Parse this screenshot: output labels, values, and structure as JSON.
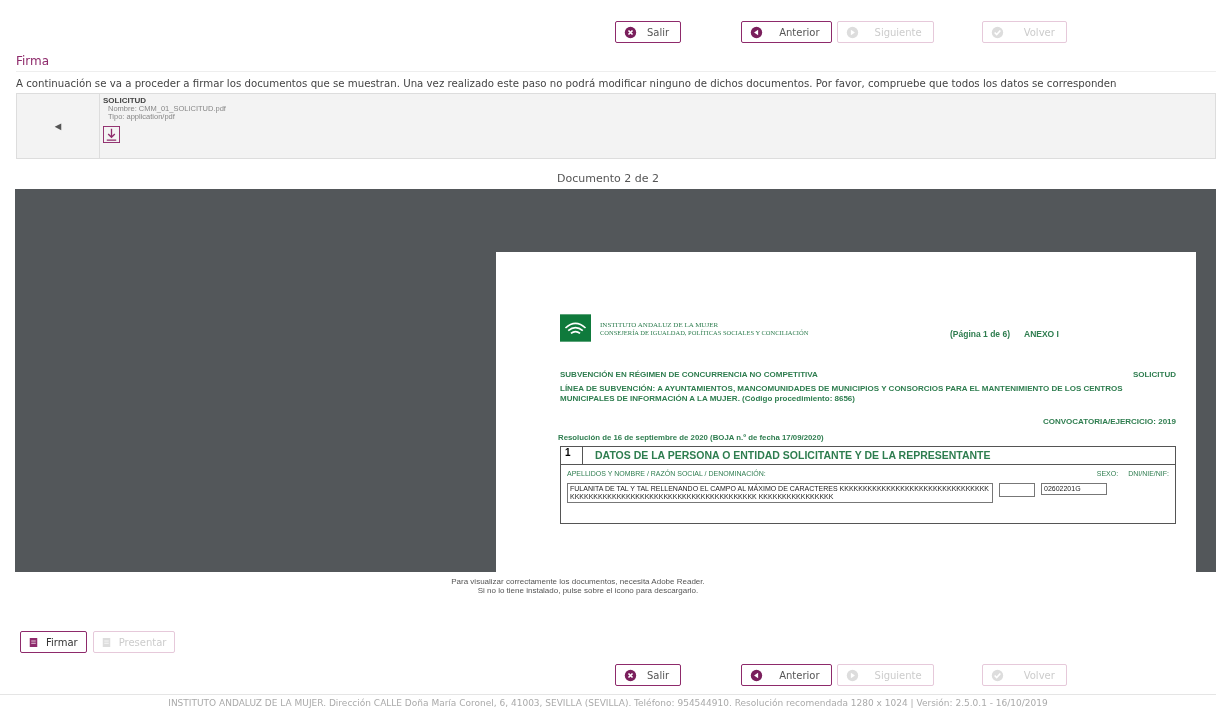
{
  "nav_top": [
    {
      "label": "Salir",
      "kind": "close",
      "disabled": false
    },
    {
      "label": "Anterior",
      "kind": "prev",
      "disabled": false
    },
    {
      "label": "Siguiente",
      "kind": "next",
      "disabled": true
    },
    {
      "label": "Volver",
      "kind": "check",
      "disabled": true
    }
  ],
  "section_title": "Firma",
  "intro": "A continuación se va a proceder a firmar los documentos que se muestran. Una vez realizado este paso no podrá modificar ninguno de dichos documentos. Por favor, compruebe que todos los datos se corresponden",
  "document": {
    "prev_arrow": "◄",
    "title": "SOLICITUD",
    "name": "Nombre: CMM_01_SOLICITUD.pdf",
    "type": "Tipo: application/pdf"
  },
  "counter": "Documento 2 de 2",
  "pdf": {
    "org_small": "INSTITUTO ANDALUZ DE LA MUJER",
    "org": "CONSEJERÍA DE IGUALDAD, POLÍTICAS SOCIALES Y CONCILIACIÓN",
    "page": "(Página 1 de 6)",
    "annex": "ANEXO I",
    "line1": "SUBVENCIÓN EN RÉGIMEN DE CONCURRENCIA NO COMPETITIVA",
    "line1_right": "SOLICITUD",
    "line2": "LÍNEA DE SUBVENCIÓN: A AYUNTAMIENTOS, MANCOMUNIDADES DE MUNICIPIOS Y CONSORCIOS PARA EL MANTENIMIENTO DE LOS CENTROS MUNICIPALES DE INFORMACIÓN A LA MUJER. (Código procedimiento: 8656)",
    "convocatoria": "CONVOCATORIA/EJERCICIO:  2019",
    "resolucion": "Resolución de 16 de septiembre de 2020 (BOJA n.º  de fecha  17/09/2020)",
    "section_number": "1",
    "section_title": "DATOS DE LA PERSONA O ENTIDAD SOLICITANTE Y DE LA REPRESENTANTE",
    "name_label": "APELLIDOS Y NOMBRE / RAZÓN SOCIAL / DENOMINACIÓN:",
    "sex_label": "SEXO:",
    "id_label": "DNI/NIE/NIF:",
    "name_value": "FULANITA DE TAL Y TAL RELLENANDO EL CAMPO AL MÁXIMO DE CARACTERES KKKKKKKKKKKKKKKKKKKKKKKKKKKKKKKKKKKKKKKKKKKKKKKKKKKKKKKKKKKKKKKKKKKKKKKK KKKKKKKKKKKKKKKK",
    "id_value": "02602201G"
  },
  "notice": [
    "Para visualizar correctamente los documentos, necesita Adobe Reader.",
    "Si no lo tiene instalado, pulse sobre el icono para descargarlo."
  ],
  "actions": [
    {
      "label": "Firmar",
      "disabled": false
    },
    {
      "label": "Presentar",
      "disabled": true
    }
  ],
  "nav_bottom": [
    {
      "label": "Salir",
      "kind": "close",
      "disabled": false
    },
    {
      "label": "Anterior",
      "kind": "prev",
      "disabled": false
    },
    {
      "label": "Siguiente",
      "kind": "next",
      "disabled": true
    },
    {
      "label": "Volver",
      "kind": "check",
      "disabled": true
    }
  ],
  "footer": "INSTITUTO ANDALUZ DE LA MUJER. Dirección CALLE Doña María Coronel, 6, 41003, SEVILLA (SEVILLA). Teléfono: 954544910. Resolución recomendada 1280 x 1024 | Versión: 2.5.0.1 - 16/10/2019"
}
